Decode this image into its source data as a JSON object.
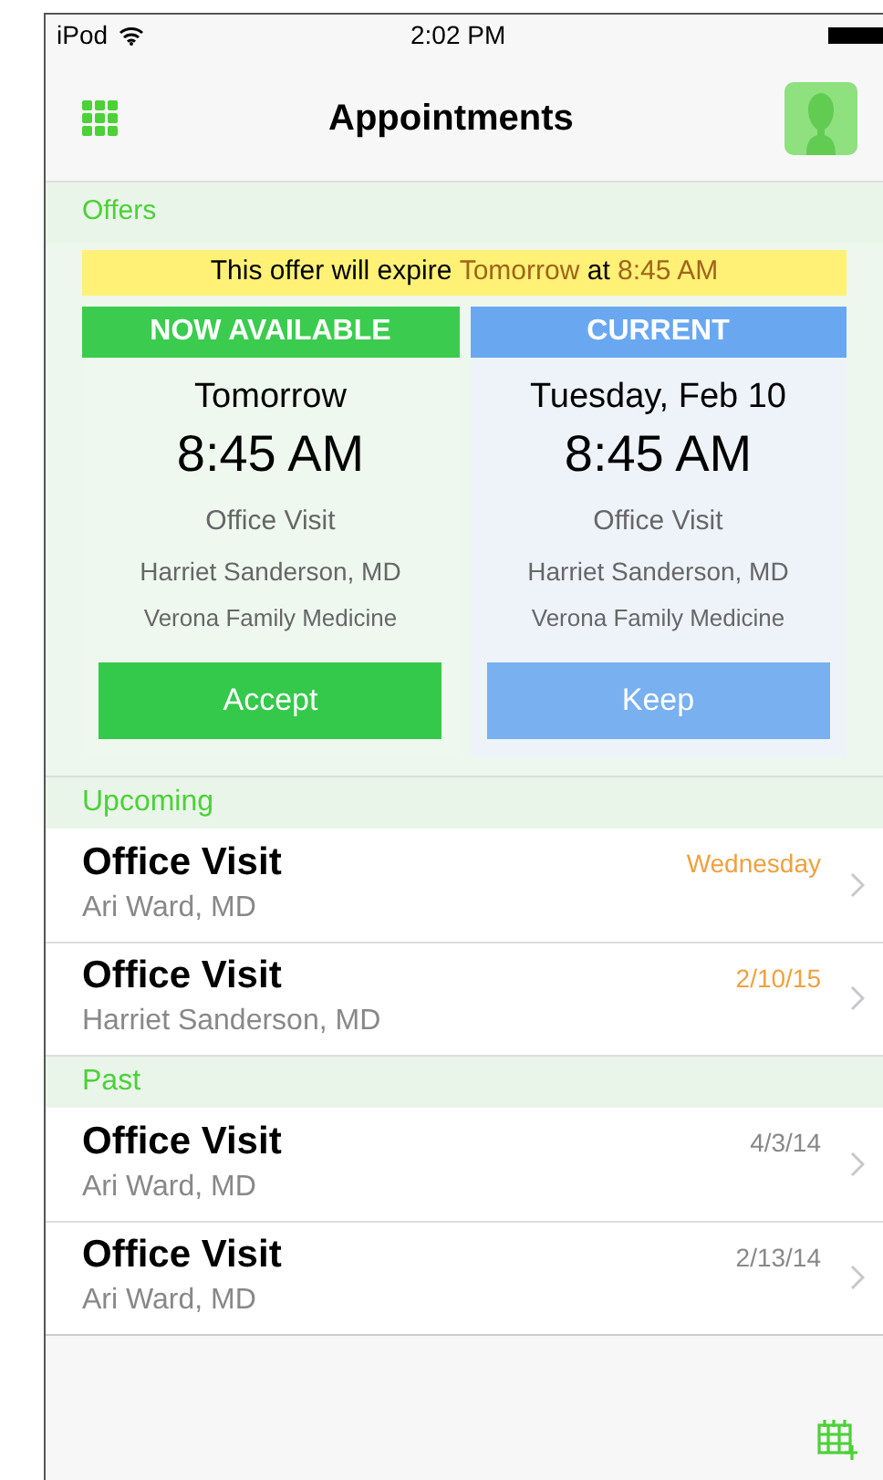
{
  "status_bar": {
    "device": "iPod",
    "time": "2:02 PM"
  },
  "nav": {
    "title": "Appointments"
  },
  "offers": {
    "header": "Offers",
    "banner": [
      {
        "text": "This offer will expire ",
        "highlight": false
      },
      {
        "text": "Tomorrow",
        "highlight": true
      },
      {
        "text": " at ",
        "highlight": false
      },
      {
        "text": "8:45 AM",
        "highlight": true
      }
    ],
    "cards": [
      {
        "kind": "offer",
        "label": "NOW AVAILABLE",
        "day": "Tomorrow",
        "time": "8:45 AM",
        "type": "Office Visit",
        "doctor": "Harriet Sanderson, MD",
        "clinic": "Verona Family Medicine",
        "button": "Accept"
      },
      {
        "kind": "current",
        "label": "CURRENT",
        "day": "Tuesday, Feb 10",
        "time": "8:45 AM",
        "type": "Office Visit",
        "doctor": "Harriet Sanderson, MD",
        "clinic": "Verona Family Medicine",
        "button": "Keep"
      }
    ]
  },
  "sections": [
    {
      "header": "Upcoming",
      "kind": "upcoming",
      "rows": [
        {
          "title": "Office Visit",
          "doctor": "Ari Ward, MD",
          "date": "Wednesday"
        },
        {
          "title": "Office Visit",
          "doctor": "Harriet Sanderson, MD",
          "date": "2/10/15"
        }
      ]
    },
    {
      "header": "Past",
      "kind": "past",
      "rows": [
        {
          "title": "Office Visit",
          "doctor": "Ari Ward, MD",
          "date": "4/3/14"
        },
        {
          "title": "Office Visit",
          "doctor": "Ari Ward, MD",
          "date": "2/13/14"
        }
      ]
    }
  ]
}
